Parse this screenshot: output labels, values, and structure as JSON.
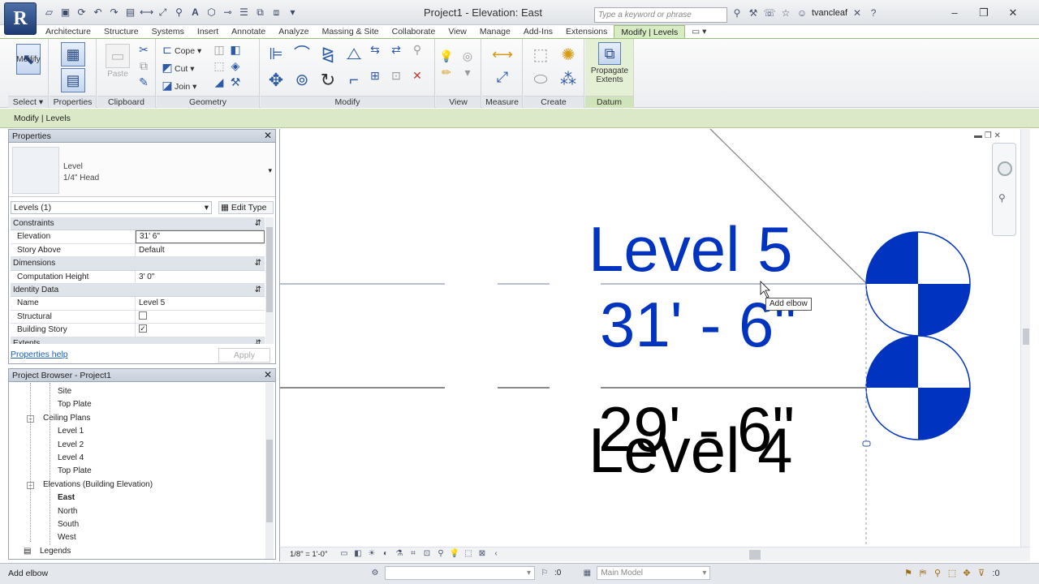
{
  "app": {
    "window_title": "Project1 - Elevation: East",
    "logo_letter": "R",
    "search_placeholder": "Type a keyword or phrase",
    "user": "tvancleaf",
    "accent": "#9ac07c"
  },
  "quick_access": [
    "open-icon",
    "save-icon",
    "sync-icon",
    "undo-icon",
    "redo-icon",
    "print-icon",
    "measure-icon",
    "dimension-icon",
    "tag-icon",
    "text-icon",
    "3d-view-icon",
    "section-icon",
    "thin-lines-icon",
    "close-hidden-icon",
    "switch-windows-icon",
    "customize-icon"
  ],
  "tabs": [
    "Architecture",
    "Structure",
    "Systems",
    "Insert",
    "Annotate",
    "Analyze",
    "Massing & Site",
    "Collaborate",
    "View",
    "Manage",
    "Add-Ins",
    "Extensions",
    "Modify | Levels"
  ],
  "active_tab": "Modify | Levels",
  "ribbon": {
    "select_label": "Select",
    "modify_label": "Modify",
    "properties_label": "Properties",
    "clipboard_label": "Clipboard",
    "paste_label": "Paste",
    "geometry_label": "Geometry",
    "cope_label": "Cope",
    "cut_label": "Cut",
    "join_label": "Join",
    "modify_panel_label": "Modify",
    "view_label": "View",
    "measure_label": "Measure",
    "create_label": "Create",
    "datum_label": "Datum",
    "propagate_line1": "Propagate",
    "propagate_line2": "Extents"
  },
  "context_bar": "Modify | Levels",
  "properties": {
    "title": "Properties",
    "family": "Level",
    "type": "1/4\" Head",
    "instance_filter": "Levels (1)",
    "edit_type": "Edit Type",
    "groups": [
      {
        "name": "Constraints",
        "rows": [
          {
            "key": "Elevation",
            "value": "31'  6\"",
            "editing": true
          },
          {
            "key": "Story Above",
            "value": "Default"
          }
        ]
      },
      {
        "name": "Dimensions",
        "rows": [
          {
            "key": "Computation Height",
            "value": "3'  0\""
          }
        ]
      },
      {
        "name": "Identity Data",
        "rows": [
          {
            "key": "Name",
            "value": "Level 5"
          },
          {
            "key": "Structural",
            "value": "",
            "checkbox": false
          },
          {
            "key": "Building Story",
            "value": "",
            "checkbox": true
          }
        ]
      },
      {
        "name": "Extents",
        "rows": []
      }
    ],
    "help_link": "Properties help",
    "apply": "Apply"
  },
  "browser": {
    "title": "Project Browser - Project1",
    "nodes": [
      {
        "label": "Site",
        "indent": 3
      },
      {
        "label": "Top Plate",
        "indent": 3
      },
      {
        "label": "Ceiling Plans",
        "indent": 2,
        "expander": "−"
      },
      {
        "label": "Level 1",
        "indent": 3
      },
      {
        "label": "Level 2",
        "indent": 3
      },
      {
        "label": "Level 4",
        "indent": 3
      },
      {
        "label": "Top Plate",
        "indent": 3
      },
      {
        "label": "Elevations (Building Elevation)",
        "indent": 2,
        "expander": "−"
      },
      {
        "label": "East",
        "indent": 3,
        "selected": true
      },
      {
        "label": "North",
        "indent": 3
      },
      {
        "label": "South",
        "indent": 3
      },
      {
        "label": "West",
        "indent": 3
      },
      {
        "label": "Legends",
        "indent": 1,
        "icon": true
      }
    ]
  },
  "canvas": {
    "level_top_name": "Level 5",
    "level_top_elev": "31' - 6\"",
    "level_bottom_name": "Level 4",
    "level_bottom_elev": "29' - 6\"",
    "tooltip": "Add elbow",
    "blue": "#0033c0",
    "line_color": "#8a98b8"
  },
  "view_control": {
    "scale": "1/8\" = 1'-0\""
  },
  "status": {
    "text": "Add elbow",
    "workset_placeholder": "",
    "counter": ":0",
    "model": "Main Model"
  }
}
